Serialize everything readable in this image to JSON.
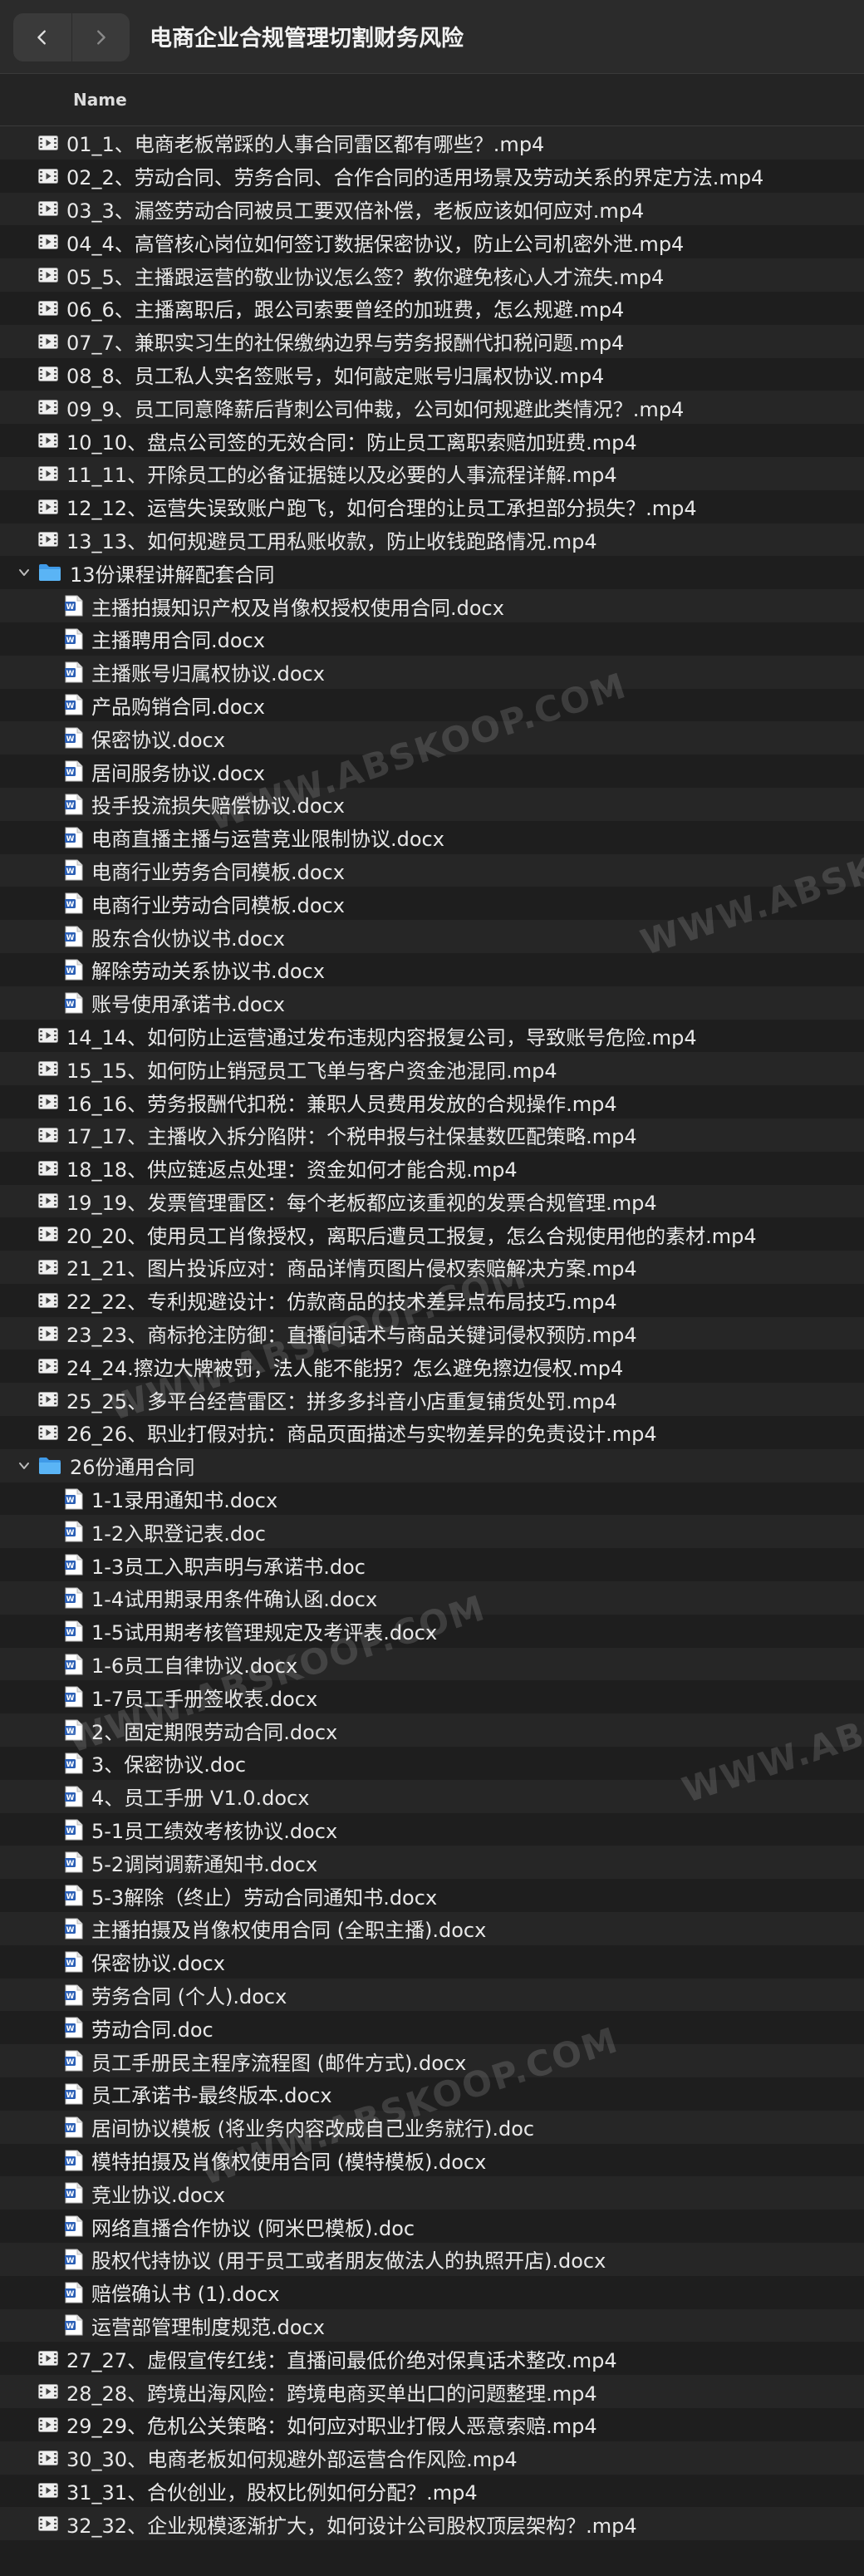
{
  "window": {
    "title": "电商企业合规管理切割财务风险",
    "column_name": "Name"
  },
  "watermark_text": "WWW.ABSKOOP.COM",
  "rows": [
    {
      "type": "video",
      "level": 0,
      "label": "01_1、电商老板常踩的人事合同雷区都有哪些？.mp4"
    },
    {
      "type": "video",
      "level": 0,
      "label": "02_2、劳动合同、劳务合同、合作合同的适用场景及劳动关系的界定方法.mp4"
    },
    {
      "type": "video",
      "level": 0,
      "label": "03_3、漏签劳动合同被员工要双倍补偿，老板应该如何应对.mp4"
    },
    {
      "type": "video",
      "level": 0,
      "label": "04_4、高管核心岗位如何签订数据保密协议，防止公司机密外泄.mp4"
    },
    {
      "type": "video",
      "level": 0,
      "label": "05_5、主播跟运营的敬业协议怎么签？教你避免核心人才流失.mp4"
    },
    {
      "type": "video",
      "level": 0,
      "label": "06_6、主播离职后，跟公司索要曾经的加班费，怎么规避.mp4"
    },
    {
      "type": "video",
      "level": 0,
      "label": "07_7、兼职实习生的社保缴纳边界与劳务报酬代扣税问题.mp4"
    },
    {
      "type": "video",
      "level": 0,
      "label": "08_8、员工私人实名签账号，如何敲定账号归属权协议.mp4"
    },
    {
      "type": "video",
      "level": 0,
      "label": "09_9、员工同意降薪后背刺公司仲裁，公司如何规避此类情况？.mp4"
    },
    {
      "type": "video",
      "level": 0,
      "label": "10_10、盘点公司签的无效合同：防止员工离职索赔加班费.mp4"
    },
    {
      "type": "video",
      "level": 0,
      "label": "11_11、开除员工的必备证据链以及必要的人事流程详解.mp4"
    },
    {
      "type": "video",
      "level": 0,
      "label": "12_12、运营失误致账户跑飞，如何合理的让员工承担部分损失？.mp4"
    },
    {
      "type": "video",
      "level": 0,
      "label": "13_13、如何规避员工用私账收款，防止收钱跑路情况.mp4"
    },
    {
      "type": "folder",
      "level": 0,
      "label": "13份课程讲解配套合同"
    },
    {
      "type": "doc",
      "level": 1,
      "label": "主播拍摄知识产权及肖像权授权使用合同.docx"
    },
    {
      "type": "doc",
      "level": 1,
      "label": "主播聘用合同.docx"
    },
    {
      "type": "doc",
      "level": 1,
      "label": "主播账号归属权协议.docx"
    },
    {
      "type": "doc",
      "level": 1,
      "label": "产品购销合同.docx"
    },
    {
      "type": "doc",
      "level": 1,
      "label": "保密协议.docx"
    },
    {
      "type": "doc",
      "level": 1,
      "label": "居间服务协议.docx"
    },
    {
      "type": "doc",
      "level": 1,
      "label": "投手投流损失赔偿协议.docx"
    },
    {
      "type": "doc",
      "level": 1,
      "label": "电商直播主播与运营竞业限制协议.docx"
    },
    {
      "type": "doc",
      "level": 1,
      "label": "电商行业劳务合同模板.docx"
    },
    {
      "type": "doc",
      "level": 1,
      "label": "电商行业劳动合同模板.docx"
    },
    {
      "type": "doc",
      "level": 1,
      "label": "股东合伙协议书.docx"
    },
    {
      "type": "doc",
      "level": 1,
      "label": "解除劳动关系协议书.docx"
    },
    {
      "type": "doc",
      "level": 1,
      "label": "账号使用承诺书.docx"
    },
    {
      "type": "video",
      "level": 0,
      "label": "14_14、如何防止运营通过发布违规内容报复公司，导致账号危险.mp4"
    },
    {
      "type": "video",
      "level": 0,
      "label": "15_15、如何防止销冠员工飞单与客户资金池混同.mp4"
    },
    {
      "type": "video",
      "level": 0,
      "label": "16_16、劳务报酬代扣税：兼职人员费用发放的合规操作.mp4"
    },
    {
      "type": "video",
      "level": 0,
      "label": "17_17、主播收入拆分陷阱：个税申报与社保基数匹配策略.mp4"
    },
    {
      "type": "video",
      "level": 0,
      "label": "18_18、供应链返点处理：资金如何才能合规.mp4"
    },
    {
      "type": "video",
      "level": 0,
      "label": "19_19、发票管理雷区：每个老板都应该重视的发票合规管理.mp4"
    },
    {
      "type": "video",
      "level": 0,
      "label": "20_20、使用员工肖像授权，离职后遭员工报复，怎么合规使用他的素材.mp4"
    },
    {
      "type": "video",
      "level": 0,
      "label": "21_21、图片投诉应对：商品详情页图片侵权索赔解决方案.mp4"
    },
    {
      "type": "video",
      "level": 0,
      "label": "22_22、专利规避设计：仿款商品的技术差异点布局技巧.mp4"
    },
    {
      "type": "video",
      "level": 0,
      "label": "23_23、商标抢注防御：直播间话术与商品关键词侵权预防.mp4"
    },
    {
      "type": "video",
      "level": 0,
      "label": "24_24.擦边大牌被罚，法人能不能拐？怎么避免擦边侵权.mp4"
    },
    {
      "type": "video",
      "level": 0,
      "label": "25_25、多平台经营雷区：拼多多抖音小店重复铺货处罚.mp4"
    },
    {
      "type": "video",
      "level": 0,
      "label": "26_26、职业打假对抗：商品页面描述与实物差异的免责设计.mp4"
    },
    {
      "type": "folder",
      "level": 0,
      "label": "26份通用合同"
    },
    {
      "type": "doc",
      "level": 1,
      "label": "1-1录用通知书.docx"
    },
    {
      "type": "doc",
      "level": 1,
      "label": "1-2入职登记表.doc"
    },
    {
      "type": "doc",
      "level": 1,
      "label": "1-3员工入职声明与承诺书.doc"
    },
    {
      "type": "doc",
      "level": 1,
      "label": "1-4试用期录用条件确认函.docx"
    },
    {
      "type": "doc",
      "level": 1,
      "label": "1-5试用期考核管理规定及考评表.docx"
    },
    {
      "type": "doc",
      "level": 1,
      "label": "1-6员工自律协议.docx"
    },
    {
      "type": "doc",
      "level": 1,
      "label": "1-7员工手册签收表.docx"
    },
    {
      "type": "doc",
      "level": 1,
      "label": "2、固定期限劳动合同.docx"
    },
    {
      "type": "doc",
      "level": 1,
      "label": "3、保密协议.doc"
    },
    {
      "type": "doc",
      "level": 1,
      "label": "4、员工手册 V1.0.docx"
    },
    {
      "type": "doc",
      "level": 1,
      "label": "5-1员工绩效考核协议.docx"
    },
    {
      "type": "doc",
      "level": 1,
      "label": "5-2调岗调薪通知书.docx"
    },
    {
      "type": "doc",
      "level": 1,
      "label": "5-3解除（终止）劳动合同通知书.docx"
    },
    {
      "type": "doc",
      "level": 1,
      "label": "主播拍摄及肖像权使用合同 (全职主播).docx"
    },
    {
      "type": "doc",
      "level": 1,
      "label": "保密协议.docx"
    },
    {
      "type": "doc",
      "level": 1,
      "label": "劳务合同 (个人).docx"
    },
    {
      "type": "doc",
      "level": 1,
      "label": "劳动合同.doc"
    },
    {
      "type": "doc",
      "level": 1,
      "label": "员工手册民主程序流程图 (邮件方式).docx"
    },
    {
      "type": "doc",
      "level": 1,
      "label": "员工承诺书-最终版本.docx"
    },
    {
      "type": "doc",
      "level": 1,
      "label": "居间协议模板 (将业务内容改成自己业务就行).doc"
    },
    {
      "type": "doc",
      "level": 1,
      "label": "模特拍摄及肖像权使用合同 (模特模板).docx"
    },
    {
      "type": "doc",
      "level": 1,
      "label": "竞业协议.docx"
    },
    {
      "type": "doc",
      "level": 1,
      "label": "网络直播合作协议 (阿米巴模板).doc"
    },
    {
      "type": "doc",
      "level": 1,
      "label": "股权代持协议 (用于员工或者朋友做法人的执照开店).docx"
    },
    {
      "type": "doc",
      "level": 1,
      "label": "赔偿确认书 (1).docx"
    },
    {
      "type": "doc",
      "level": 1,
      "label": "运营部管理制度规范.docx"
    },
    {
      "type": "video",
      "level": 0,
      "label": "27_27、虚假宣传红线：直播间最低价绝对保真话术整改.mp4"
    },
    {
      "type": "video",
      "level": 0,
      "label": "28_28、跨境出海风险：跨境电商买单出口的问题整理.mp4"
    },
    {
      "type": "video",
      "level": 0,
      "label": "29_29、危机公关策略：如何应对职业打假人恶意索赔.mp4"
    },
    {
      "type": "video",
      "level": 0,
      "label": "30_30、电商老板如何规避外部运营合作风险.mp4"
    },
    {
      "type": "video",
      "level": 0,
      "label": "31_31、合伙创业，股权比例如何分配？.mp4"
    },
    {
      "type": "video",
      "level": 0,
      "label": "32_32、企业规模逐渐扩大，如何设计公司股权顶层架构？.mp4"
    }
  ]
}
